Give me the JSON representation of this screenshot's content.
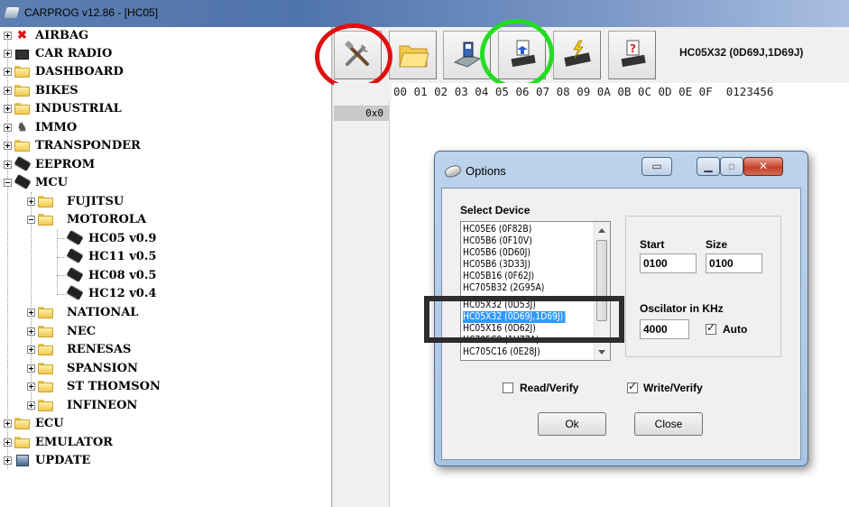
{
  "window": {
    "title": "CARPROG  v12.86 - [HC05]"
  },
  "tree": {
    "top": [
      {
        "label": "AIRBAG",
        "icon": "airbag-icon"
      },
      {
        "label": "CAR RADIO",
        "icon": "radio-icon"
      },
      {
        "label": "DASHBOARD",
        "icon": "folder-icon"
      },
      {
        "label": "BIKES",
        "icon": "folder-icon"
      },
      {
        "label": "INDUSTRIAL",
        "icon": "folder-icon"
      },
      {
        "label": "IMMO",
        "icon": "immo-icon"
      },
      {
        "label": "TRANSPONDER",
        "icon": "folder-icon"
      },
      {
        "label": "EEPROM",
        "icon": "chip-icon"
      },
      {
        "label": "MCU",
        "icon": "chip-icon"
      }
    ],
    "mcu_children": [
      {
        "label": "FUJITSU"
      },
      {
        "label": "MOTOROLA"
      },
      {
        "label": "HC05 v0.9"
      },
      {
        "label": "HC11 v0.5"
      },
      {
        "label": "HC08 v0.5"
      },
      {
        "label": "HC12 v0.4"
      },
      {
        "label": "NATIONAL"
      },
      {
        "label": "NEC"
      },
      {
        "label": "RENESAS"
      },
      {
        "label": "SPANSION"
      },
      {
        "label": "ST THOMSON"
      },
      {
        "label": "INFINEON"
      }
    ],
    "bottom": [
      {
        "label": "ECU"
      },
      {
        "label": "EMULATOR"
      },
      {
        "label": "UPDATE"
      }
    ]
  },
  "toolbar": {
    "device_label": "HC05X32 (0D69J,1D69J)",
    "buttons": [
      "settings-tools",
      "open-folder",
      "save-disk",
      "read-chip",
      "write-chip",
      "verify-chip"
    ],
    "annotations": {
      "red_circle_color": "#e01010",
      "green_circle_color": "#22dd22"
    }
  },
  "hex": {
    "header": "00 01 02 03 04 05 06 07 08 09 0A 0B 0C 0D 0E 0F  0123456",
    "first_address": "0x0"
  },
  "dialog": {
    "title": "Options",
    "select_device_label": "Select Device",
    "devices": [
      "HC05E6 (0F82B)",
      "HC05B6 (0F10V)",
      "HC05B6 (0D60J)",
      "HC05B6 (3D33J)",
      "HC05B16 (0F62J)",
      "HC705B32 (2G95A)",
      "HC05X32 (0D53J)",
      "HC05X32 (0D69J,1D69J)",
      "HC05X16 (0D62J)",
      "HC705C9 (1H77A)",
      "HC705C16 (0E28J)"
    ],
    "selected_index": 7,
    "start_label": "Start",
    "start_value": "0100",
    "size_label": "Size",
    "size_value": "0100",
    "oscillator_label": "Oscilator in KHz",
    "oscillator_value": "4000",
    "auto_label": "Auto",
    "auto_checked": true,
    "read_verify_label": "Read/Verify",
    "read_verify_checked": false,
    "write_verify_label": "Write/Verify",
    "write_verify_checked": true,
    "ok_label": "Ok",
    "close_label": "Close",
    "highlight_color": "#2d2d2d"
  }
}
